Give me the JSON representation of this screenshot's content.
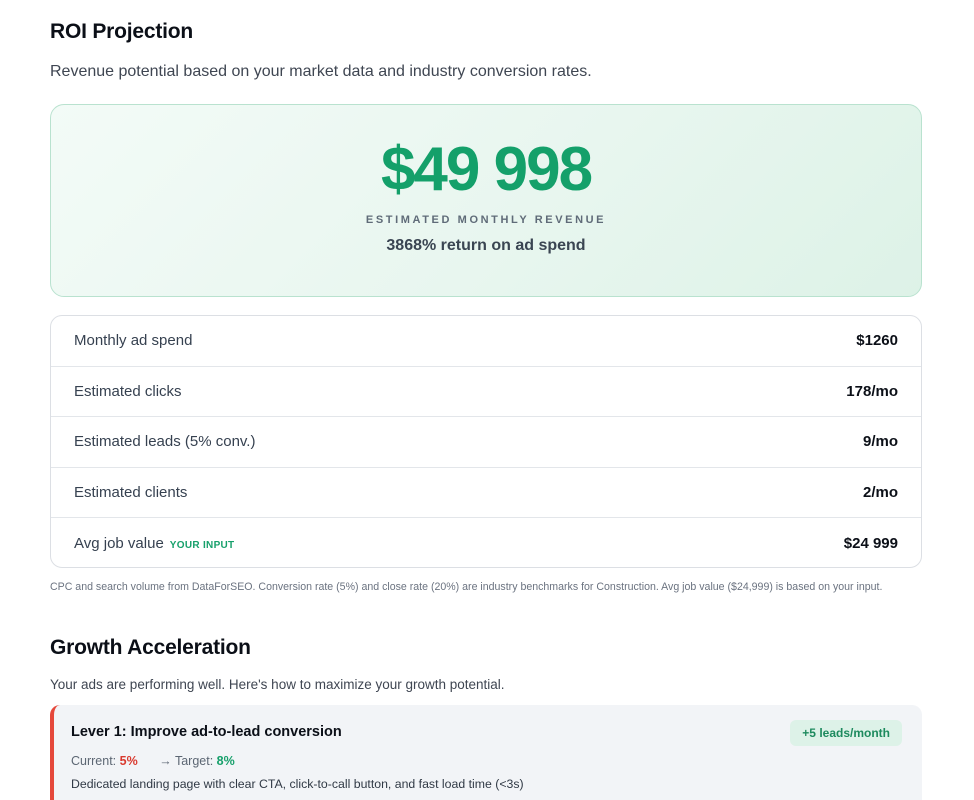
{
  "roi": {
    "title": "ROI Projection",
    "subtitle": "Revenue potential based on your market data and industry conversion rates.",
    "hero": {
      "value": "$49 998",
      "label": "ESTIMATED MONTHLY REVENUE",
      "sub": "3868% return on ad spend"
    },
    "rows": [
      {
        "label": "Monthly ad spend",
        "value": "$1260"
      },
      {
        "label": "Estimated clicks",
        "value": "178/mo"
      },
      {
        "label": "Estimated leads (5% conv.)",
        "value": "9/mo"
      },
      {
        "label": "Estimated clients",
        "value": "2/mo"
      },
      {
        "label": "Avg job value",
        "badge": "YOUR INPUT",
        "value": "$24 999"
      }
    ],
    "footnote": "CPC and search volume from DataForSEO. Conversion rate (5%) and close rate (20%) are industry benchmarks for Construction. Avg job value ($24,999) is based on your input."
  },
  "growth": {
    "title": "Growth Acceleration",
    "subtitle": "Your ads are performing well. Here's how to maximize your growth potential.",
    "lever": {
      "title": "Lever 1: Improve ad-to-lead conversion",
      "pill": "+5 leads/month",
      "current_label": "Current:",
      "current_value": "5%",
      "target_label": "→ Target:",
      "target_value": "8%",
      "description": "Dedicated landing page with clear CTA, click-to-call button, and fast load time (<3s)"
    }
  },
  "colors": {
    "accent_green": "#14a06a",
    "current_red": "#d93a2f",
    "lever_border": "#e5483b"
  }
}
